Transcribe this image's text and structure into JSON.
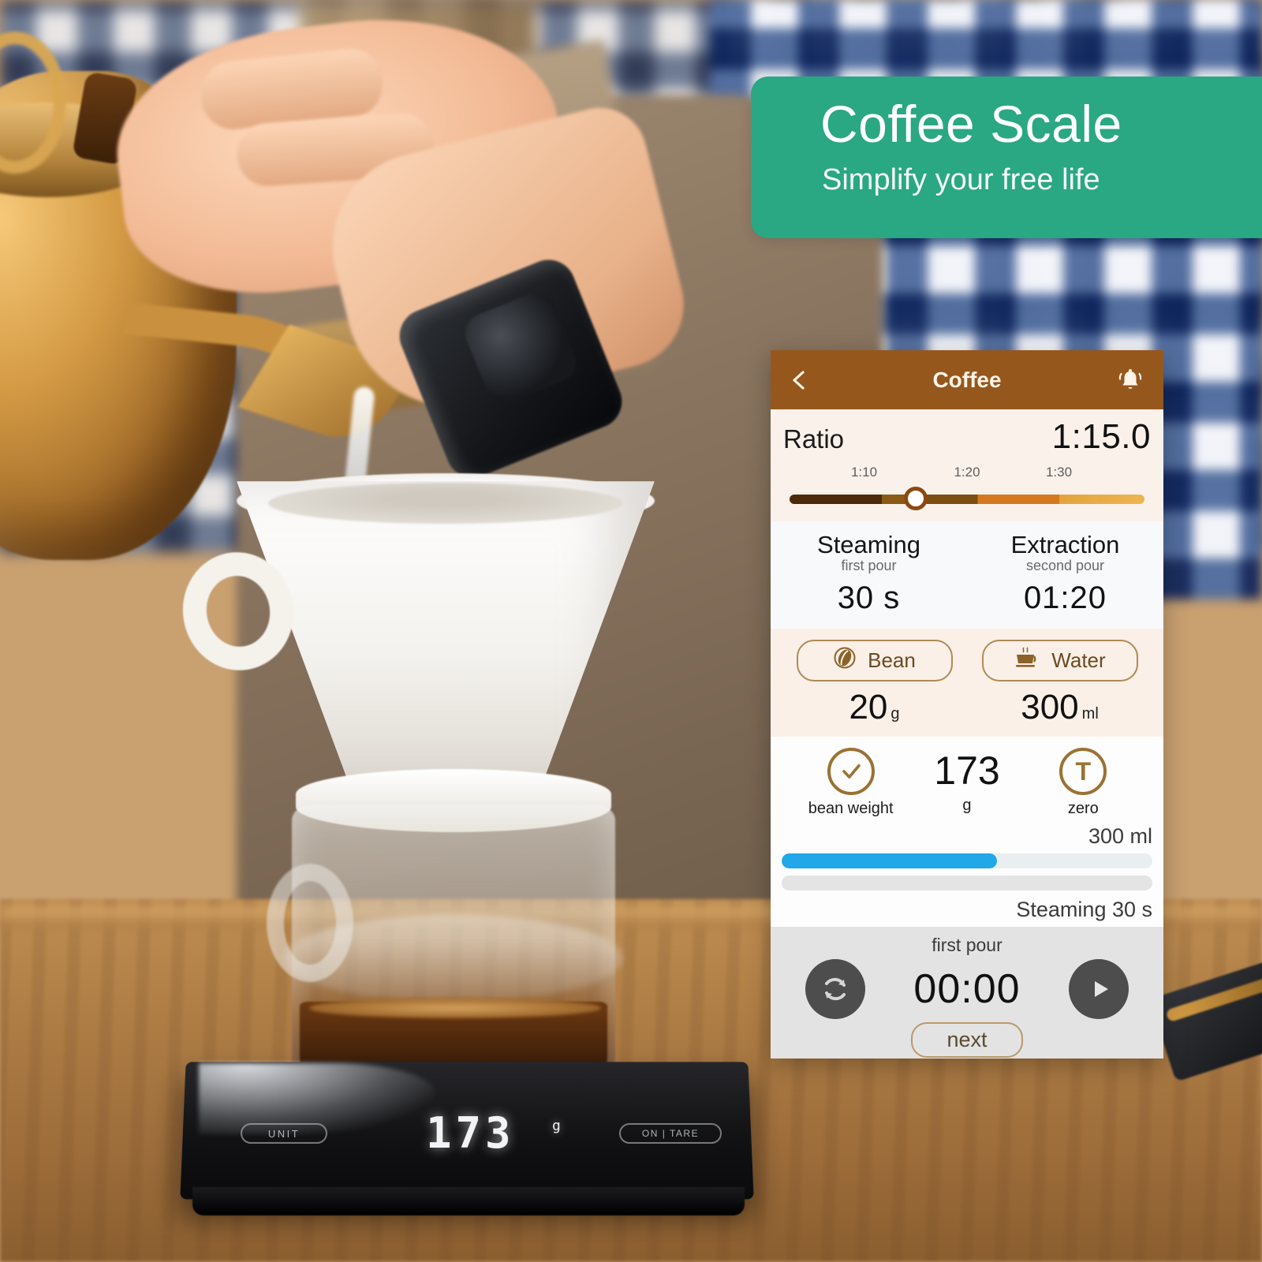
{
  "banner": {
    "title": "Coffee Scale",
    "subtitle": "Simplify your free life",
    "color": "#2aa783"
  },
  "app": {
    "header": {
      "title": "Coffee",
      "back_icon": "chevron-left-icon",
      "alarm_icon": "bell-icon",
      "bar_color": "#96571d"
    },
    "ratio": {
      "label": "Ratio",
      "value": "1:15.0",
      "ticks": [
        "1:10",
        "1:20",
        "1:30"
      ],
      "slider_position_percent": 36
    },
    "pours": [
      {
        "title": "Steaming",
        "subtitle": "first pour",
        "value": "30 s"
      },
      {
        "title": "Extraction",
        "subtitle": "second pour",
        "value": "01:20"
      }
    ],
    "bean_water": [
      {
        "icon": "coffee-bean-icon",
        "label": "Bean",
        "amount": "20",
        "unit": "g"
      },
      {
        "icon": "coffee-cup-icon",
        "label": "Water",
        "amount": "300",
        "unit": "ml"
      }
    ],
    "weight_row": {
      "left": {
        "icon": "check-circle-icon",
        "caption": "bean weight"
      },
      "center": {
        "value": "173",
        "unit": "g"
      },
      "right": {
        "icon": "tare-t-icon",
        "glyph": "T",
        "caption": "zero"
      }
    },
    "progress": {
      "target_label": "300 ml",
      "water_percent": 58,
      "time_percent": 0,
      "status": "Steaming 30 s",
      "fill_color": "#22a7e8"
    },
    "timer": {
      "stage_label": "first pour",
      "reset_icon": "reset-circular-arrows-icon",
      "time": "00:00",
      "play_icon": "play-icon",
      "next_label": "next"
    }
  },
  "scale": {
    "unit_button": "UNIT",
    "tare_button": "ON | TARE",
    "display_value": "173",
    "display_unit": "g"
  }
}
